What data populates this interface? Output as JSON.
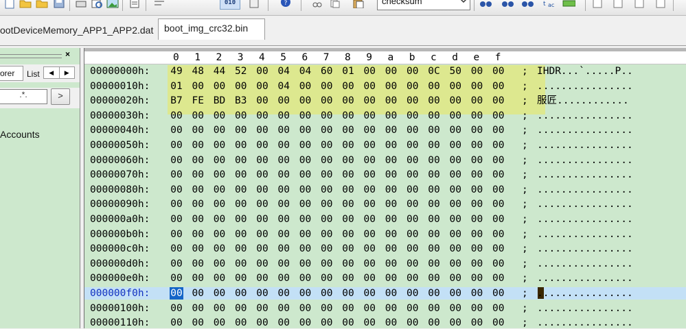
{
  "toolbar": {
    "icons": [
      "new-file-icon",
      "open-folder-icon",
      "folder-icon",
      "save-icon",
      "print-icon",
      "print-preview-icon",
      "image-icon",
      "document-icon",
      "word-wrap-icon",
      "hex-mode-icon",
      "properties-icon",
      "help-icon",
      "cut-icon",
      "copy-icon",
      "paste-icon",
      "checksum-combo",
      "find-icon",
      "find-next-icon",
      "find-prev-icon",
      "replace-icon",
      "goto-icon",
      "align-left-icon",
      "align-center-icon",
      "align-right-icon",
      "align-justify-icon"
    ],
    "hex_mode_label": "010",
    "combo_value": "checksum"
  },
  "tabs": [
    {
      "label": "ootDeviceMemory_APP1_APP2.dat",
      "active": false
    },
    {
      "label": "boot_img_crc32.bin",
      "active": true
    }
  ],
  "leftpane": {
    "tab_explorer": "orer",
    "tab_lists": "List",
    "search_value": ".*.",
    "go_label": ">",
    "tree_item": "Accounts"
  },
  "hex": {
    "columns": [
      "0",
      "1",
      "2",
      "3",
      "4",
      "5",
      "6",
      "7",
      "8",
      "9",
      "a",
      "b",
      "c",
      "d",
      "e",
      "f"
    ],
    "rows": [
      {
        "offset": "00000000h:",
        "bytes": [
          "49",
          "48",
          "44",
          "52",
          "00",
          "04",
          "04",
          "60",
          "01",
          "00",
          "00",
          "00",
          "0C",
          "50",
          "00",
          "00"
        ],
        "ascii": "IHDR...`.....P.."
      },
      {
        "offset": "00000010h:",
        "bytes": [
          "01",
          "00",
          "00",
          "00",
          "00",
          "04",
          "00",
          "00",
          "00",
          "00",
          "00",
          "00",
          "00",
          "00",
          "00",
          "00"
        ],
        "ascii": "................"
      },
      {
        "offset": "00000020h:",
        "bytes": [
          "B7",
          "FE",
          "BD",
          "B3",
          "00",
          "00",
          "00",
          "00",
          "00",
          "00",
          "00",
          "00",
          "00",
          "00",
          "00",
          "00"
        ],
        "ascii": "服匠............"
      },
      {
        "offset": "00000030h:",
        "bytes": [
          "00",
          "00",
          "00",
          "00",
          "00",
          "00",
          "00",
          "00",
          "00",
          "00",
          "00",
          "00",
          "00",
          "00",
          "00",
          "00"
        ],
        "ascii": "................"
      },
      {
        "offset": "00000040h:",
        "bytes": [
          "00",
          "00",
          "00",
          "00",
          "00",
          "00",
          "00",
          "00",
          "00",
          "00",
          "00",
          "00",
          "00",
          "00",
          "00",
          "00"
        ],
        "ascii": "................"
      },
      {
        "offset": "00000050h:",
        "bytes": [
          "00",
          "00",
          "00",
          "00",
          "00",
          "00",
          "00",
          "00",
          "00",
          "00",
          "00",
          "00",
          "00",
          "00",
          "00",
          "00"
        ],
        "ascii": "................"
      },
      {
        "offset": "00000060h:",
        "bytes": [
          "00",
          "00",
          "00",
          "00",
          "00",
          "00",
          "00",
          "00",
          "00",
          "00",
          "00",
          "00",
          "00",
          "00",
          "00",
          "00"
        ],
        "ascii": "................"
      },
      {
        "offset": "00000070h:",
        "bytes": [
          "00",
          "00",
          "00",
          "00",
          "00",
          "00",
          "00",
          "00",
          "00",
          "00",
          "00",
          "00",
          "00",
          "00",
          "00",
          "00"
        ],
        "ascii": "................"
      },
      {
        "offset": "00000080h:",
        "bytes": [
          "00",
          "00",
          "00",
          "00",
          "00",
          "00",
          "00",
          "00",
          "00",
          "00",
          "00",
          "00",
          "00",
          "00",
          "00",
          "00"
        ],
        "ascii": "................"
      },
      {
        "offset": "00000090h:",
        "bytes": [
          "00",
          "00",
          "00",
          "00",
          "00",
          "00",
          "00",
          "00",
          "00",
          "00",
          "00",
          "00",
          "00",
          "00",
          "00",
          "00"
        ],
        "ascii": "................"
      },
      {
        "offset": "000000a0h:",
        "bytes": [
          "00",
          "00",
          "00",
          "00",
          "00",
          "00",
          "00",
          "00",
          "00",
          "00",
          "00",
          "00",
          "00",
          "00",
          "00",
          "00"
        ],
        "ascii": "................"
      },
      {
        "offset": "000000b0h:",
        "bytes": [
          "00",
          "00",
          "00",
          "00",
          "00",
          "00",
          "00",
          "00",
          "00",
          "00",
          "00",
          "00",
          "00",
          "00",
          "00",
          "00"
        ],
        "ascii": "................"
      },
      {
        "offset": "000000c0h:",
        "bytes": [
          "00",
          "00",
          "00",
          "00",
          "00",
          "00",
          "00",
          "00",
          "00",
          "00",
          "00",
          "00",
          "00",
          "00",
          "00",
          "00"
        ],
        "ascii": "................"
      },
      {
        "offset": "000000d0h:",
        "bytes": [
          "00",
          "00",
          "00",
          "00",
          "00",
          "00",
          "00",
          "00",
          "00",
          "00",
          "00",
          "00",
          "00",
          "00",
          "00",
          "00"
        ],
        "ascii": "................"
      },
      {
        "offset": "000000e0h:",
        "bytes": [
          "00",
          "00",
          "00",
          "00",
          "00",
          "00",
          "00",
          "00",
          "00",
          "00",
          "00",
          "00",
          "00",
          "00",
          "00",
          "00"
        ],
        "ascii": "................"
      },
      {
        "offset": "000000f0h:",
        "bytes": [
          "00",
          "00",
          "00",
          "00",
          "00",
          "00",
          "00",
          "00",
          "00",
          "00",
          "00",
          "00",
          "00",
          "00",
          "00",
          "00"
        ],
        "ascii": "................",
        "current": true
      },
      {
        "offset": "00000100h:",
        "bytes": [
          "00",
          "00",
          "00",
          "00",
          "00",
          "00",
          "00",
          "00",
          "00",
          "00",
          "00",
          "00",
          "00",
          "00",
          "00",
          "00"
        ],
        "ascii": "................"
      },
      {
        "offset": "00000110h:",
        "bytes": [
          "00",
          "00",
          "00",
          "00",
          "00",
          "00",
          "00",
          "00",
          "00",
          "00",
          "00",
          "00",
          "00",
          "00",
          "00",
          "00"
        ],
        "ascii": "................"
      }
    ],
    "separator": ";",
    "colors": {
      "background": "#cde8cd",
      "highlight": "#e2e87a",
      "current_row": "#c3e0f6",
      "selection": "#1565c8"
    }
  }
}
